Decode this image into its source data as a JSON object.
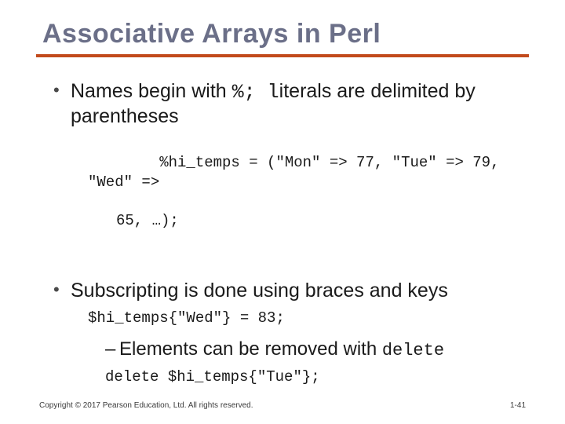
{
  "title": "Associative Arrays in Perl",
  "bullets": {
    "b1_pre": "Names begin with ",
    "b1_code": "%; l",
    "b1_post": "iterals are delimited by parentheses",
    "code1_l1": "%hi_temps = (\"Mon\" => 77, \"Tue\" => 79, \"Wed\" =>",
    "code1_l2": "65, …);",
    "b2": "Subscripting is done using braces and keys",
    "code2": "$hi_temps{\"Wed\"} = 83;",
    "sub1_pre": "Elements can be removed with ",
    "sub1_code": "delete",
    "code3": "delete $hi_temps{\"Tue\"};"
  },
  "footer": {
    "copyright": "Copyright © 2017 Pearson Education, Ltd. All rights reserved.",
    "page": "1-41"
  }
}
